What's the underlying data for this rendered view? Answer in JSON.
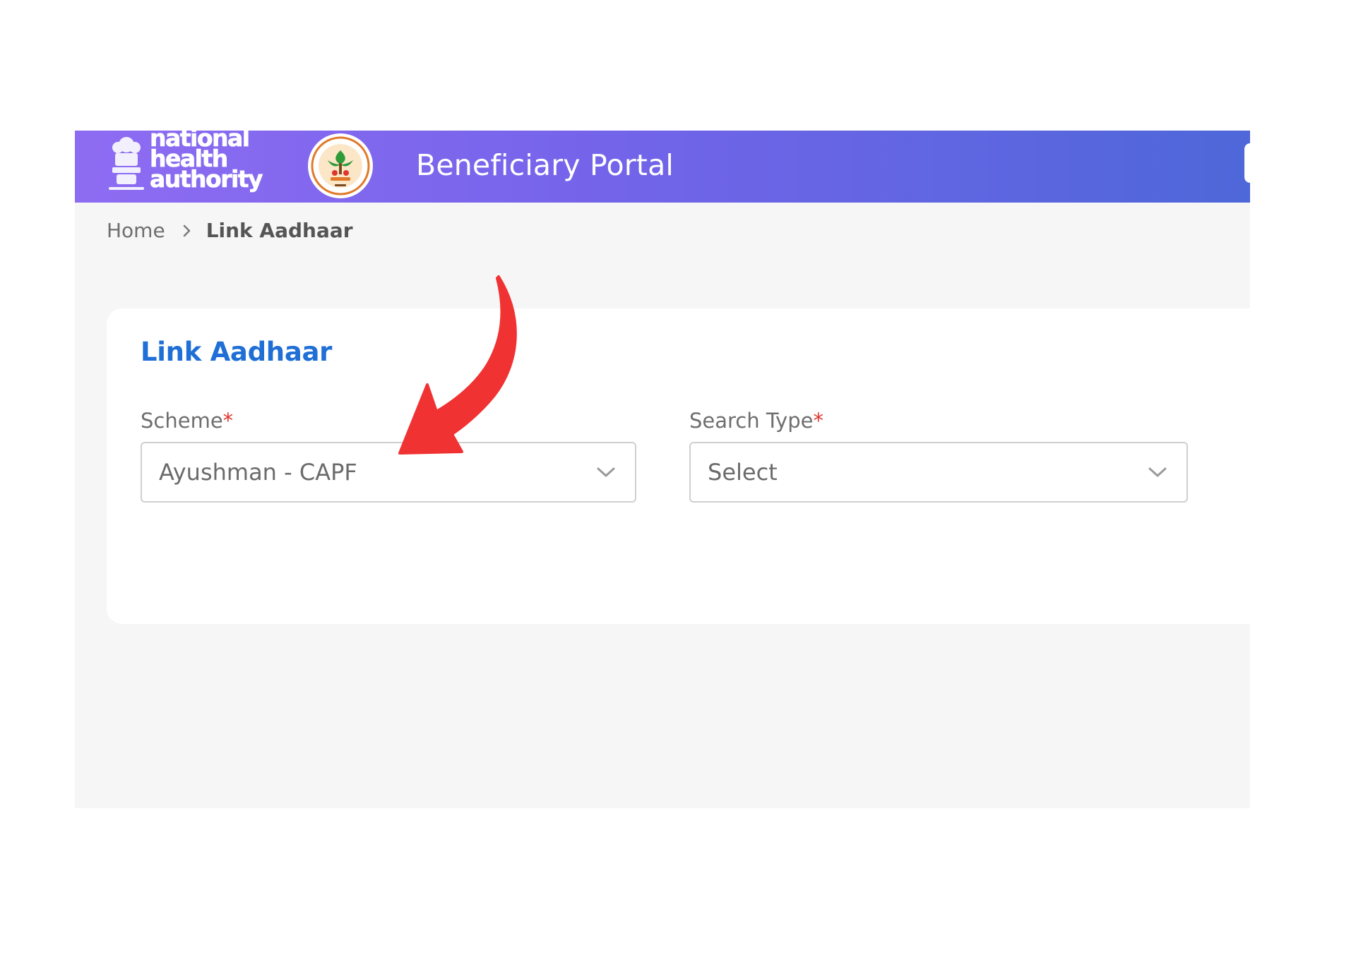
{
  "header": {
    "org_name_line1": "national",
    "org_name_line2": "health",
    "org_name_line3": "authority",
    "portal_title": "Beneficiary Portal"
  },
  "breadcrumb": {
    "home": "Home",
    "current": "Link Aadhaar"
  },
  "card": {
    "title": "Link Aadhaar",
    "scheme": {
      "label": "Scheme",
      "required_mark": "*",
      "value": "Ayushman - CAPF"
    },
    "search_type": {
      "label": "Search Type",
      "required_mark": "*",
      "value": "Select"
    }
  },
  "annotation": {
    "arrow_color": "#f03232"
  },
  "colors": {
    "header_gradient_start": "#8e6cf2",
    "header_gradient_end": "#4e67d9",
    "accent_blue": "#1f6fd6",
    "required_red": "#e0342c"
  }
}
